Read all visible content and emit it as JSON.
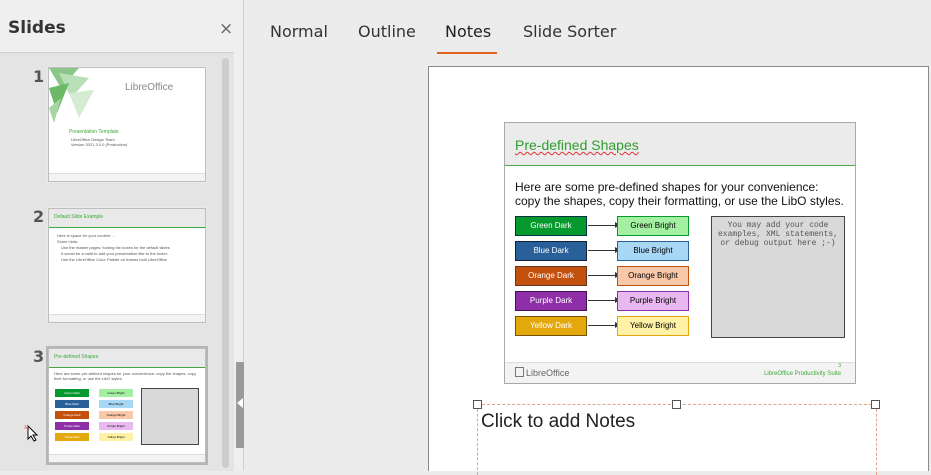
{
  "slides_pane": {
    "title": "Slides",
    "close_glyph": "×",
    "slides": [
      {
        "number": "1",
        "logo": "LibreOffice",
        "title": "Presentation Template",
        "bullets": [
          "LibreOffice Design Team",
          "Version 2021.3.0.0 (Production)"
        ]
      },
      {
        "number": "2",
        "title": "Default Slide Example",
        "bullets": [
          "Here is space for your content ...",
          "Some hints:",
          "Use the master pages: footing the boxes for the default slides",
          "It would be a valid to add your presentation title to the footer.",
          "Use the LibreOffice Color Palette on frames built LibreOffice"
        ]
      },
      {
        "number": "3",
        "title": "Pre-defined Shapes"
      }
    ]
  },
  "tabs": {
    "items": [
      "Normal",
      "Outline",
      "Notes",
      "Slide Sorter"
    ],
    "active": "Notes"
  },
  "slide": {
    "title": "Pre-defined Shapes",
    "body": "Here are some pre-defined shapes for your convenience: copy the shapes, copy their formatting, or use the LibO styles.",
    "shapes": [
      {
        "dark": "Green Dark",
        "bright": "Green Bright",
        "dark_color": "#069a2e",
        "bright_color": "#a3f0a3"
      },
      {
        "dark": "Blue Dark",
        "bright": "Blue Bright",
        "dark_color": "#2a6099",
        "bright_color": "#a8d6f5"
      },
      {
        "dark": "Orange Dark",
        "bright": "Orange Bright",
        "dark_color": "#c4500d",
        "bright_color": "#f8c8a8"
      },
      {
        "dark": "Purple Dark",
        "bright": "Purple Bright",
        "dark_color": "#8e2fa8",
        "bright_color": "#e9b8f0"
      },
      {
        "dark": "Yellow Dark",
        "bright": "Yellow Bright",
        "dark_color": "#e3a80c",
        "bright_color": "#fff2a6"
      }
    ],
    "code_box": "You may add your code examples, XML statements, or debug output here ;-)",
    "footer_logo": "LibreOffice",
    "footer_product": "LibreOffice Productivity Suite",
    "footer_number": "3"
  },
  "notes": {
    "placeholder": "Click to add Notes"
  },
  "colors": {
    "accent_tab": "#e06317",
    "brand_green": "#3aaa35"
  }
}
